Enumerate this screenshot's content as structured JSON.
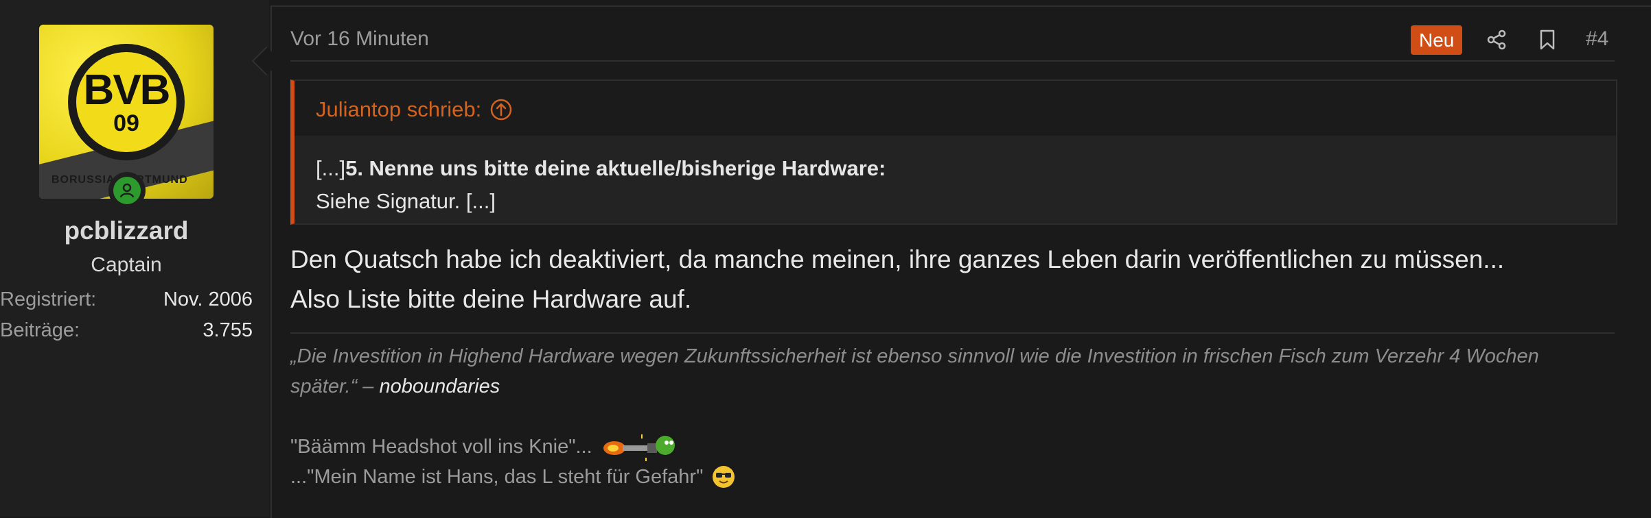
{
  "user": {
    "avatar_caption": "BORUSSIA DORTMUND",
    "avatar_letters": "BVB",
    "avatar_number": "09",
    "name": "pcblizzard",
    "title": "Captain",
    "stats": [
      {
        "label": "Registriert:",
        "value": "Nov. 2006"
      },
      {
        "label": "Beiträge:",
        "value": "3.755"
      }
    ]
  },
  "post": {
    "timestamp": "Vor 16 Minuten",
    "badge": "Neu",
    "number": "#4",
    "icons": [
      "share-icon",
      "bookmark-icon"
    ],
    "quote": {
      "author": "Juliantop schrieb:",
      "prefix": "[...]",
      "bold": "5. Nenne uns bitte deine aktuelle/bisherige Hardware:",
      "line2": "Siehe Signatur. [...]"
    },
    "message": {
      "line1": "Den Quatsch habe ich deaktiviert, da manche meinen, ihre ganzes Leben darin veröffentlichen zu müssen...",
      "line2": "Also Liste bitte deine Hardware auf."
    },
    "signature": {
      "quote": "„Die Investition in Highend Hardware wegen Zukunftssicherheit ist ebenso sinnvoll wie die Investition in frischen Fisch zum Verzehr 4 Wochen später.“ –",
      "author": "noboundaries",
      "line2": "\"Bäämm Headshot voll ins Knie\"...",
      "line3": "...\"Mein Name ist Hans, das L steht für Gefahr\""
    }
  },
  "colors": {
    "accent": "#d04d15",
    "quote_author": "#d4631f",
    "online": "#2d9a2d"
  }
}
